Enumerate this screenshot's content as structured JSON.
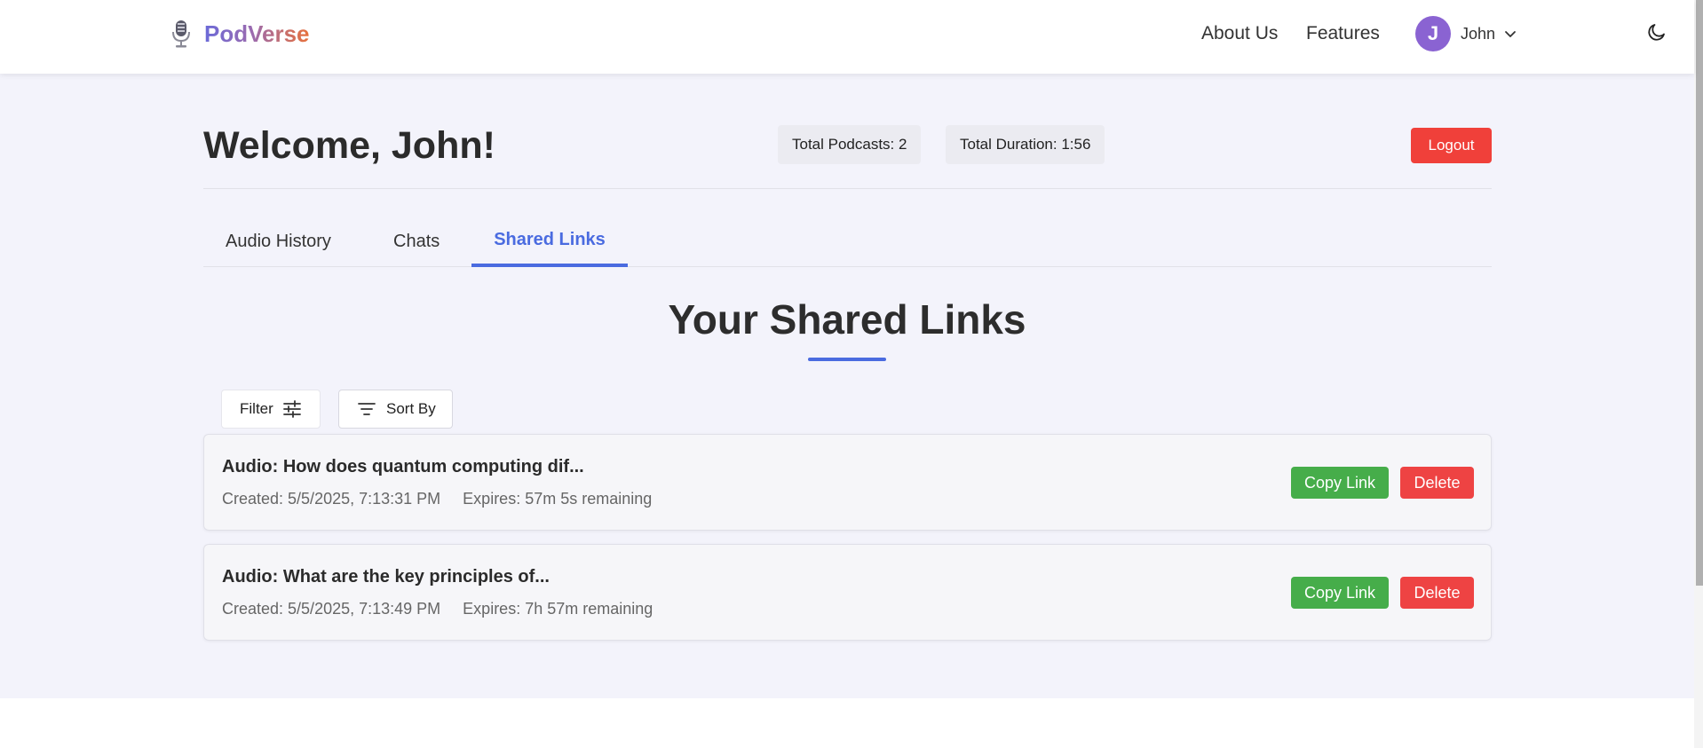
{
  "header": {
    "brand": "PodVerse",
    "nav": {
      "about": "About Us",
      "features": "Features"
    },
    "user": {
      "initial": "J",
      "name": "John"
    }
  },
  "dashboard": {
    "welcome": "Welcome, John!",
    "stats": {
      "total_podcasts": "Total Podcasts: 2",
      "total_duration": "Total Duration: 1:56"
    },
    "logout_label": "Logout"
  },
  "tabs": [
    {
      "label": "Audio History",
      "active": false
    },
    {
      "label": "Chats",
      "active": false
    },
    {
      "label": "Shared Links",
      "active": true
    }
  ],
  "shared": {
    "title": "Your Shared Links",
    "filter_label": "Filter",
    "sort_label": "Sort By",
    "links": [
      {
        "title": "Audio: How does quantum computing dif...",
        "created": "Created: 5/5/2025, 7:13:31 PM",
        "expires": "Expires: 57m 5s remaining",
        "copy_label": "Copy Link",
        "delete_label": "Delete"
      },
      {
        "title": "Audio: What are the key principles of...",
        "created": "Created: 5/5/2025, 7:13:49 PM",
        "expires": "Expires: 7h 57m remaining",
        "copy_label": "Copy Link",
        "delete_label": "Delete"
      }
    ]
  },
  "icons": [
    "microphone-icon",
    "chevron-down-icon",
    "moon-icon",
    "sliders-icon",
    "sort-lines-icon"
  ],
  "colors": {
    "accent": "#4a6be0",
    "logout": "#f0403a",
    "copy": "#46ad4a",
    "delete": "#ee4343",
    "avatar": "#8a63d2"
  }
}
